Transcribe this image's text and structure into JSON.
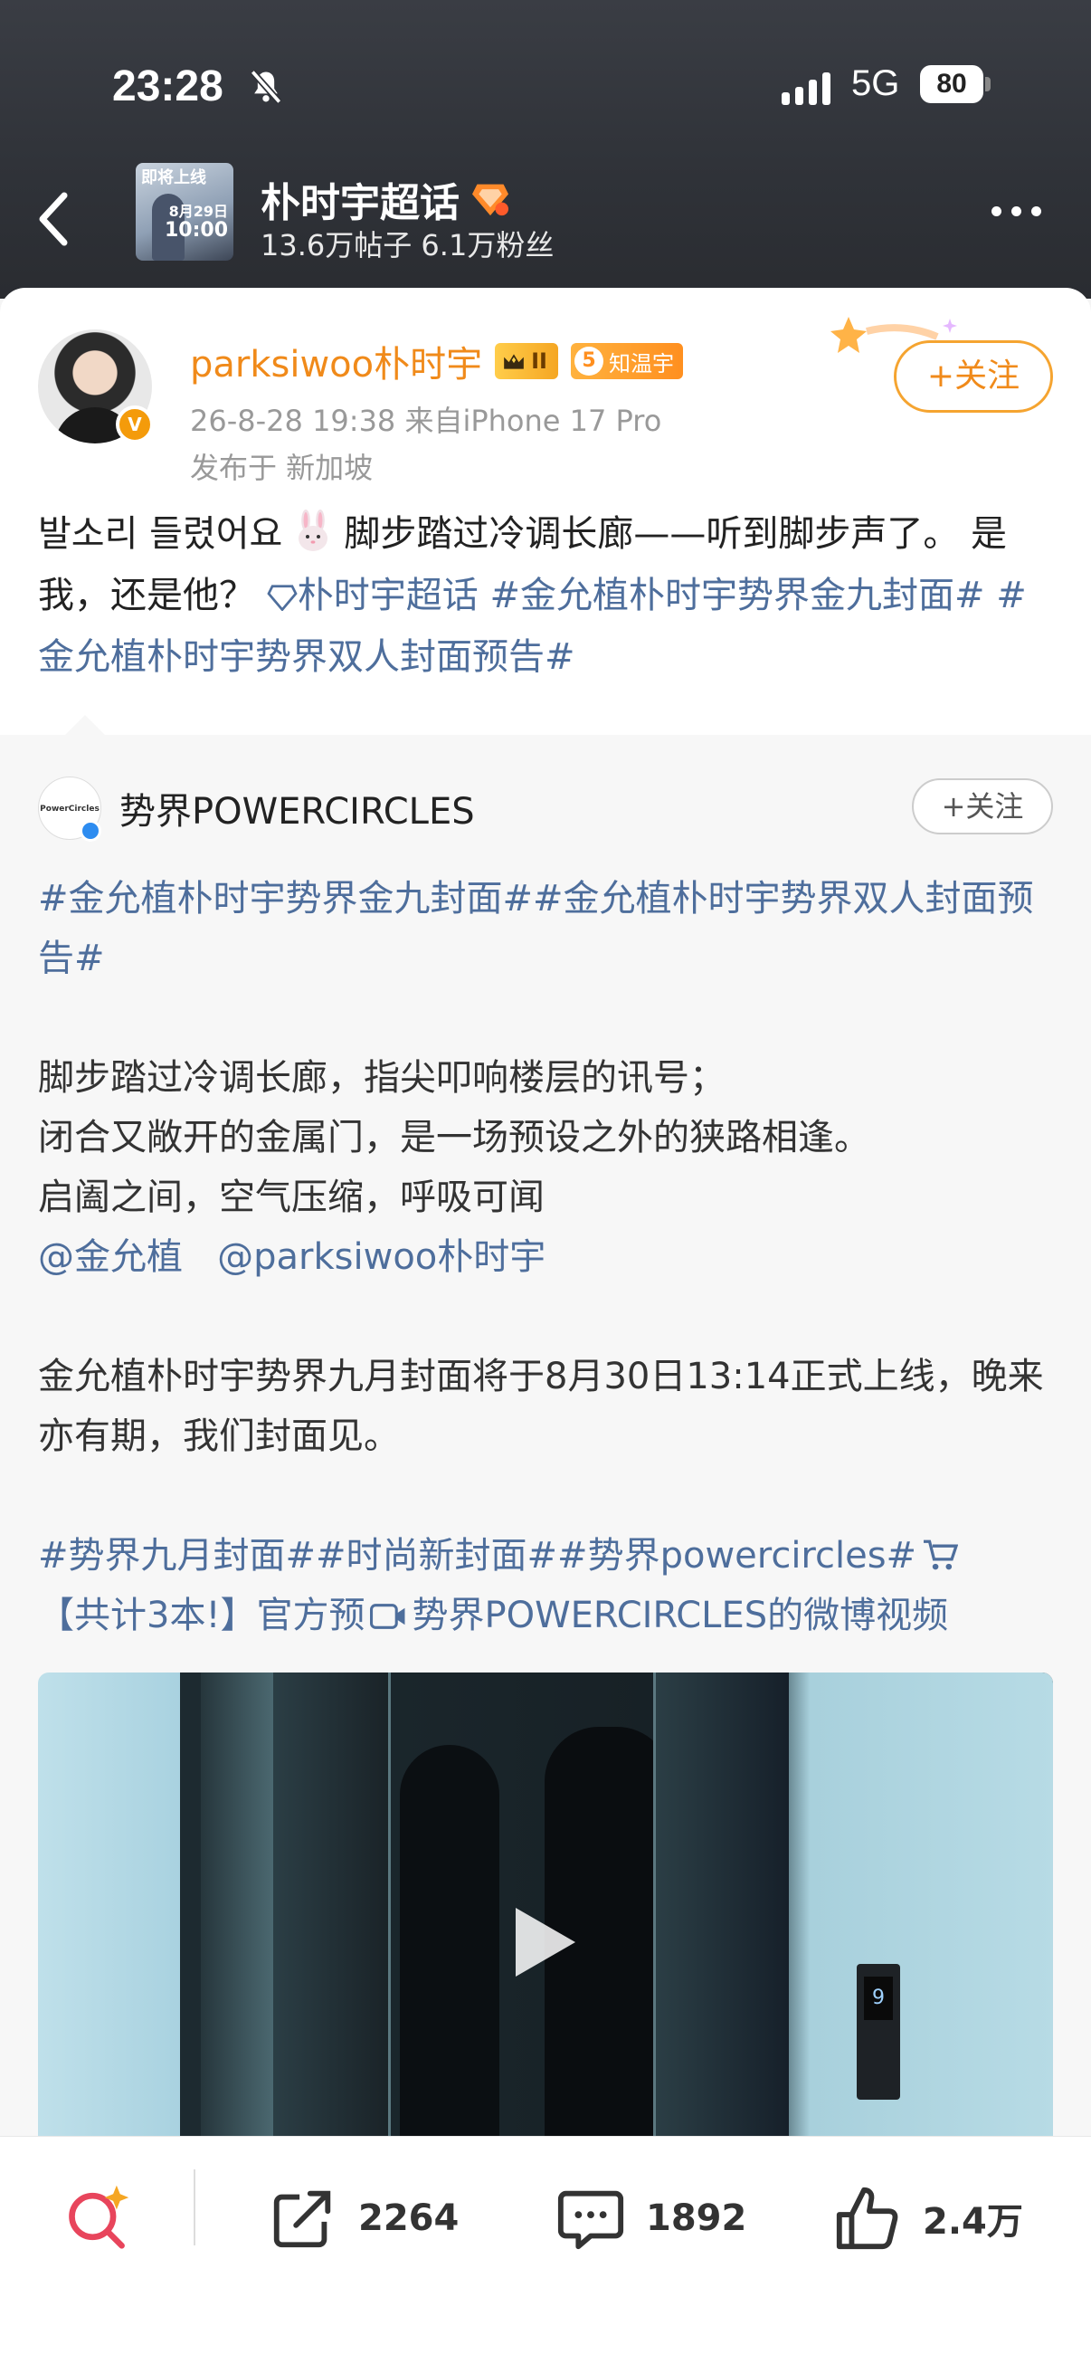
{
  "status_bar": {
    "time": "23:28",
    "network": "5G",
    "battery": "80"
  },
  "topic": {
    "thumb_line1": "即将上线",
    "thumb_date": "8月29日",
    "thumb_time": "10:00",
    "title": "朴时宇超话",
    "stats": "13.6万帖子 6.1万粉丝"
  },
  "post": {
    "username": "parksiwoo朴时宇",
    "rank_badge": "II",
    "fan_level": "5",
    "fan_badge": "知温宇",
    "meta": "26-8-28 19:38 来自iPhone 17 Pro",
    "location": "发布于 新加坡",
    "follow_label": "+关注",
    "text_part1": "발소리 들렸어요",
    "text_part2": "脚步踏过冷调长廊——听到脚步声了。 是我，还是他？",
    "tag_supertopic": "朴时宇超话",
    "tag1": "#金允植朴时宇势界金九封面#",
    "tag2": "#金允植朴时宇势界双人封面预告#"
  },
  "repost": {
    "avatar_text": "PowerCircles",
    "name": "势界POWERCIRCLES",
    "follow_label": "+关注",
    "tags_line": "#金允植朴时宇势界金九封面##金允植朴时宇势界双人封面预告#",
    "para1": "脚步踏过冷调长廊，指尖叩响楼层的讯号；",
    "para2": "闭合又敞开的金属门，是一场预设之外的狭路相逢。",
    "para3": "启阖之间，空气压缩，呼吸可闻",
    "mention1": "@金允植",
    "mention2": "@parksiwoo朴时宇",
    "para4": "金允植朴时宇势界九月封面将于8月30日13:14正式上线，晚来亦有期，我们封面见。",
    "tags_line2": "#势界九月封面##时尚新封面##势界powercircles#",
    "shop_text": "【共计3本!】官方预",
    "video_link": "势界POWERCIRCLES的微博视频",
    "video_floor": "9"
  },
  "bottom_bar": {
    "share_count": "2264",
    "comment_count": "1892",
    "like_count": "2.4万"
  },
  "colors": {
    "accent_orange": "#f08a1a",
    "link_blue": "#4e6e9c",
    "header_bg": "#2f3238"
  }
}
